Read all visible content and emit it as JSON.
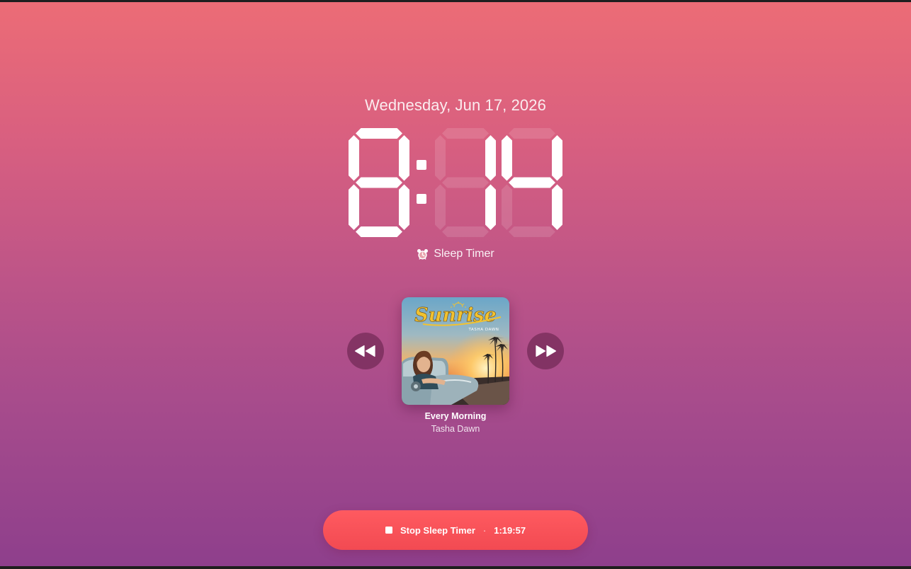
{
  "date": "Wednesday, Jun 17, 2026",
  "clock": {
    "hour": "8",
    "minute_tens": "1",
    "minute_ones": "4",
    "display": "8:14"
  },
  "sleep_timer_label": "Sleep Timer",
  "track": {
    "title": "Every Morning",
    "artist": "Tasha Dawn",
    "album_art": {
      "title": "Sunrise",
      "artist": "TASHA DAWN"
    }
  },
  "stop_button": {
    "label": "Stop Sleep Timer",
    "separator": "·",
    "remaining": "1:19:57"
  },
  "icons": {
    "alarm": "alarm-clock-icon",
    "previous": "rewind-icon",
    "next": "fast-forward-icon",
    "stop": "stop-square-icon"
  },
  "colors": {
    "background_top": "#ec6c76",
    "background_bottom": "#8e3f8c",
    "stop_button": "#f24a52"
  }
}
